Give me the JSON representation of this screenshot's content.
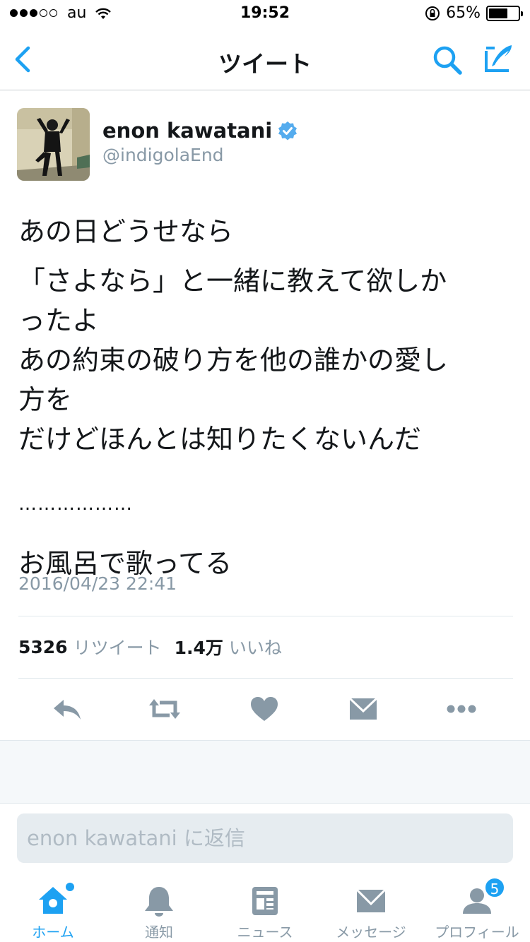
{
  "status_bar": {
    "carrier": "au",
    "time": "19:52",
    "battery": "65%",
    "battery_level": 0.65
  },
  "nav": {
    "title": "ツイート",
    "back_icon": "chevron-left-icon",
    "search_icon": "search-icon",
    "compose_icon": "compose-icon"
  },
  "tweet": {
    "author_name": "enon kawatani",
    "author_handle": "@indigolaEnd",
    "verified": true,
    "text_lines": [
      "あの日どうせなら",
      "「さよなら」と一緒に教えて欲しか\nったよ\nあの約束の破り方を他の誰かの愛し\n方を\nだけどほんとは知りたくないんだ",
      "………………",
      "お風呂で歌ってる"
    ],
    "date": "2016/04/23 22:41",
    "retweet_count": "5326",
    "retweet_label": "リツイート",
    "like_count": "1.4万",
    "like_label": "いいね"
  },
  "reply": {
    "placeholder": "enon kawatani に返信"
  },
  "tabs": [
    {
      "label": "ホーム",
      "icon": "home-icon",
      "active": true
    },
    {
      "label": "通知",
      "icon": "bell-icon"
    },
    {
      "label": "ニュース",
      "icon": "news-icon"
    },
    {
      "label": "メッセージ",
      "icon": "mail-icon"
    },
    {
      "label": "プロフィール",
      "icon": "profile-icon",
      "badge": "5"
    }
  ],
  "colors": {
    "accent": "#1da1f2",
    "secondary_text": "#8899a6",
    "icon_gray": "#8899a6"
  }
}
